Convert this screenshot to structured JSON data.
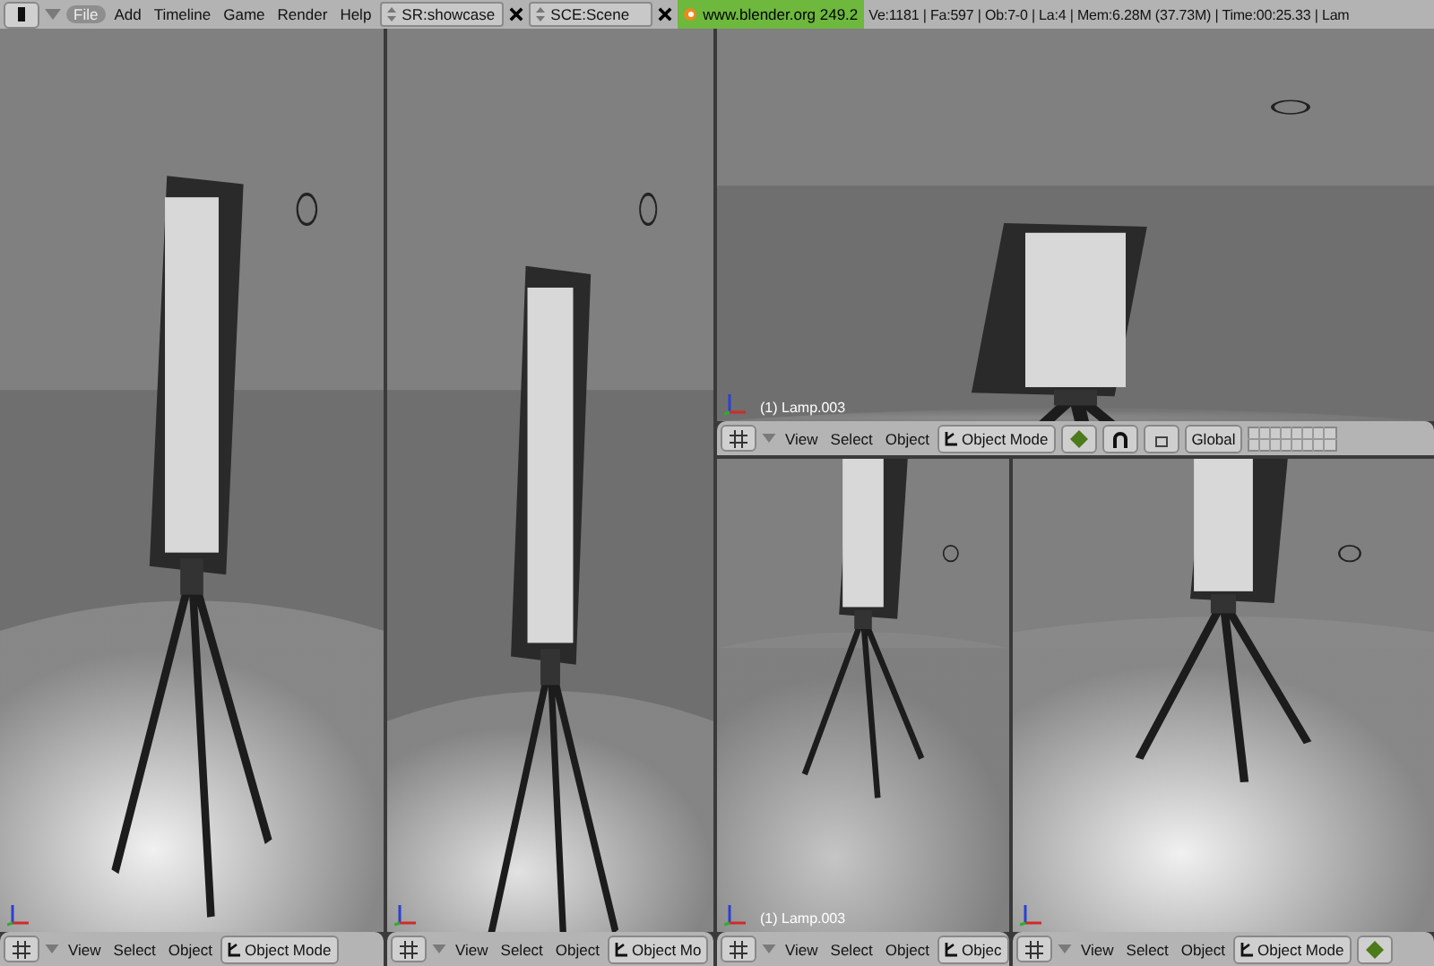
{
  "top_bar": {
    "menus": [
      {
        "label": "File",
        "selected": true
      },
      {
        "label": "Add",
        "selected": false
      },
      {
        "label": "Timeline",
        "selected": false
      },
      {
        "label": "Game",
        "selected": false
      },
      {
        "label": "Render",
        "selected": false
      },
      {
        "label": "Help",
        "selected": false
      }
    ],
    "screen": "SR:showcase",
    "scene": "SCE:Scene",
    "version": "www.blender.org 249.2",
    "stats": "Ve:1181 | Fa:597 | Ob:7-0 | La:4  | Mem:6.28M (37.73M)  | Time:00:25.33 | Lam"
  },
  "viewports": [
    {
      "kind": "picture",
      "header": {
        "menus": [
          "View",
          "Select",
          "Object"
        ],
        "mode": "Object Mode"
      }
    },
    {
      "kind": "picture",
      "header": {
        "menus": [
          "View",
          "Select",
          "Object"
        ],
        "mode": "Object Mo"
      }
    },
    {
      "kind": "picture",
      "object_label": "(1) Lamp.003",
      "header": {
        "menus": [
          "View",
          "Select",
          "Object"
        ],
        "mode": "Object Mode",
        "shading_button": true,
        "manipulator_buttons": true,
        "orientation": "Global",
        "layers": true
      }
    },
    {
      "kind": "picture",
      "object_label": "(1) Lamp.003",
      "header": {
        "menus": [
          "View",
          "Select",
          "Object"
        ],
        "mode": "Objec"
      }
    },
    {
      "kind": "picture",
      "header": {
        "menus": [
          "View",
          "Select",
          "Object"
        ],
        "mode": "Object Mode",
        "shading_button": true
      }
    }
  ]
}
